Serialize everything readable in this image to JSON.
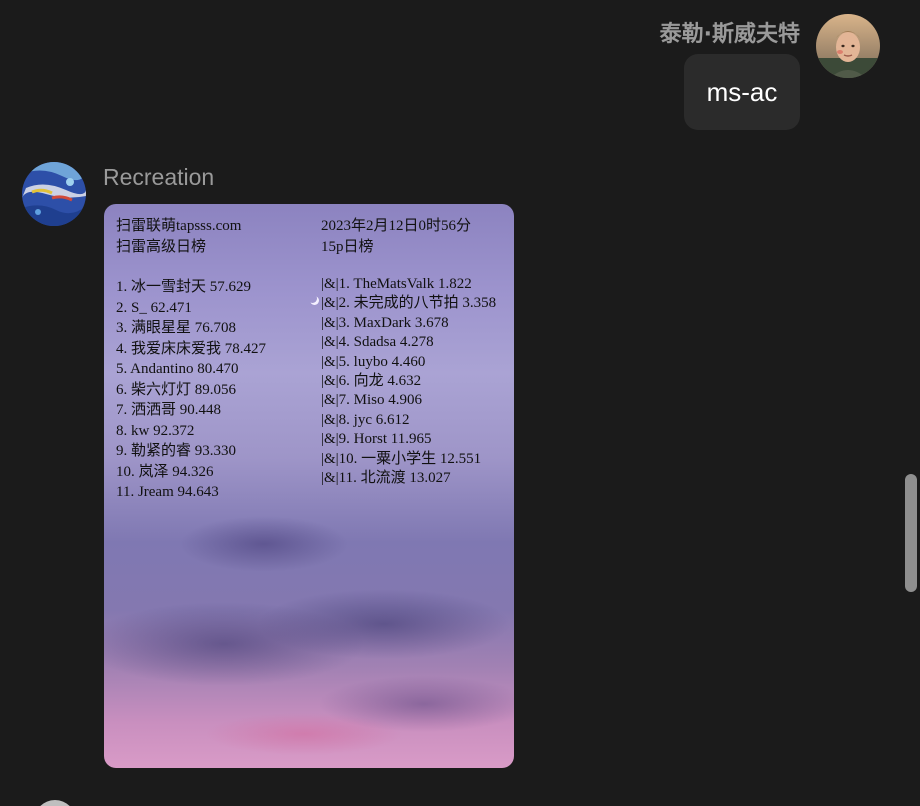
{
  "outgoing": {
    "sender_name": "泰勒·斯威夫特",
    "message": "ms-ac"
  },
  "incoming": {
    "sender_name": "Recreation",
    "image": {
      "header_left": [
        "扫雷联萌tapsss.com",
        "扫雷高级日榜"
      ],
      "header_right": [
        "2023年2月12日0时56分",
        "15p日榜"
      ],
      "list_left": [
        "1. 冰一雪封天 57.629",
        "2. S_ 62.471",
        "3. 满眼星星 76.708",
        "4. 我爱床床爱我 78.427",
        "5. Andantino 80.470",
        "6. 柴六灯灯 89.056",
        "7. 洒洒哥 90.448",
        "8. kw 92.372",
        "9. 勒紧的睿 93.330",
        "10. 岚泽 94.326",
        "11. Jream 94.643"
      ],
      "list_right": [
        "|&|1. TheMatsValk 1.822",
        "|&|2. 未完成的八节拍 3.358",
        "|&|3. MaxDark 3.678",
        "|&|4. Sdadsa 4.278",
        "|&|5. luybo 4.460",
        "|&|6. 向龙 4.632",
        "|&|7. Miso 4.906",
        "|&|8. jyc 6.612",
        "|&|9. Horst 11.965",
        "|&|10. 一粟小学生 12.551",
        "|&|11. 北流渡 13.027"
      ]
    }
  }
}
